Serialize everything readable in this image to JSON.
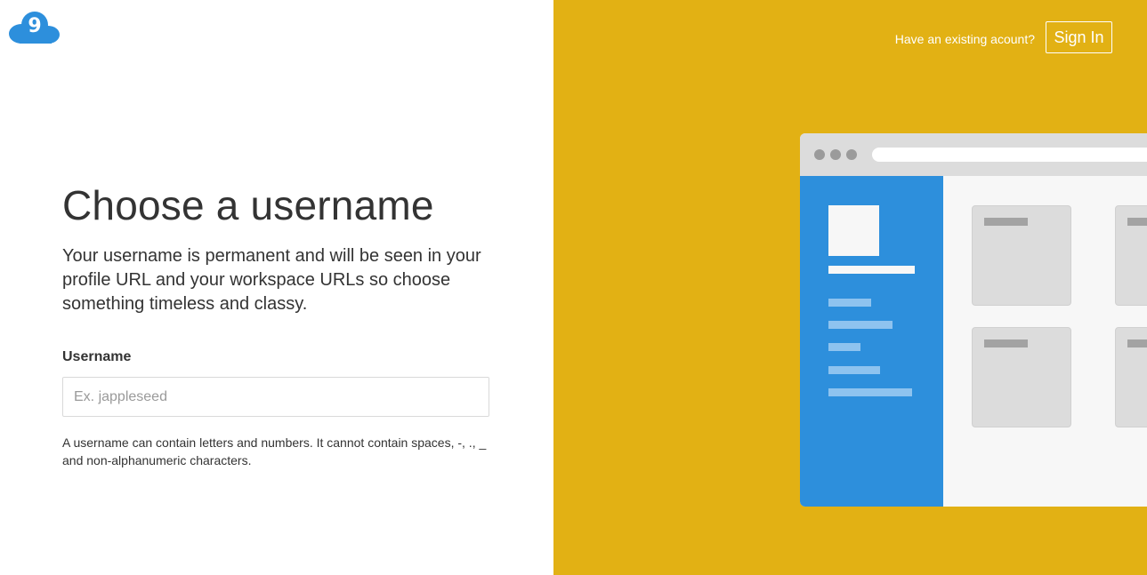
{
  "header": {
    "existing_account_text": "Have an existing acount?",
    "sign_in_label": "Sign In"
  },
  "logo": {
    "glyph": "9",
    "icon": "cloud-nine-logo-icon"
  },
  "form": {
    "title": "Choose a username",
    "intro": "Your username is permanent and will be seen in your profile URL and your workspace URLs so choose something timeless and classy.",
    "username_label": "Username",
    "username_placeholder": "Ex. jappleseed",
    "username_value": "",
    "hint": "A username can contain letters and numbers. It cannot contain spaces, -, ., _ and non-alphanumeric characters."
  },
  "colors": {
    "accent_yellow": "#e2b114",
    "logo_blue": "#2d8fdc",
    "sidebar_blue": "#2d8fdc",
    "text_dark": "#333333"
  }
}
